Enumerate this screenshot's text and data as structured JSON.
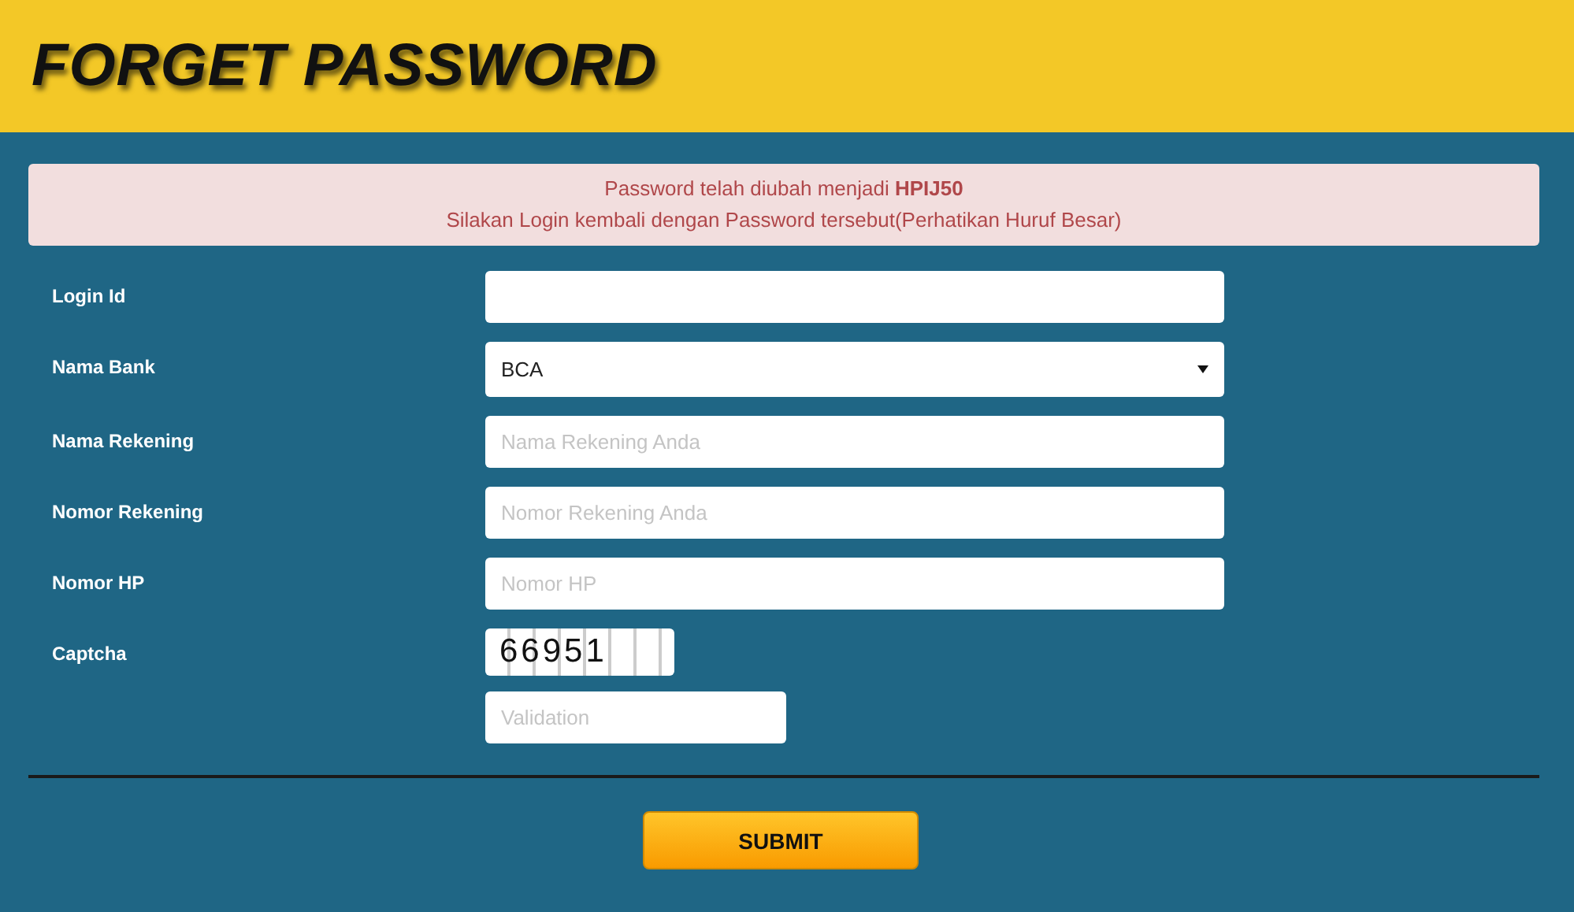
{
  "header": {
    "title": "FORGET PASSWORD"
  },
  "alert": {
    "lines": [
      "Password telah diubah menjadi **HPIJ50**",
      "Silakan Login kembali dengan Password tersebut(Perhatikan Huruf Besar)"
    ]
  },
  "form": {
    "fields": [
      {
        "label": "Login Id",
        "kind": "text"
      },
      {
        "label": "Nama Bank",
        "kind": "select",
        "value": "BCA"
      },
      {
        "label": "Nama Rekening",
        "kind": "text",
        "placeholder": "Nama Rekening Anda"
      },
      {
        "label": "Nomor Rekening",
        "kind": "text",
        "placeholder": "Nomor Rekening Anda"
      },
      {
        "label": "Nomor HP",
        "kind": "text",
        "placeholder": "Nomor HP"
      },
      {
        "label": "Captcha",
        "kind": "captcha",
        "code": "66951",
        "placeholder": "Validation"
      }
    ]
  },
  "submit": {
    "label": "SUBMIT"
  }
}
